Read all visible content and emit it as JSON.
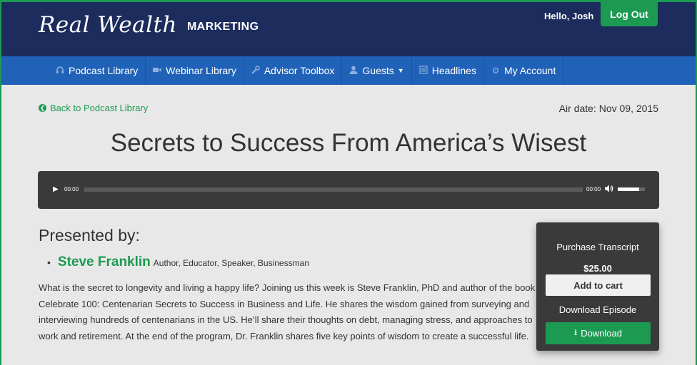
{
  "header": {
    "logo_script": "Real Wealth",
    "logo_word": "MARKETING",
    "greeting": "Hello, Josh",
    "logout_label": "Log Out"
  },
  "nav": {
    "items": [
      {
        "label": "Podcast Library",
        "icon": "headphones-icon"
      },
      {
        "label": "Webinar Library",
        "icon": "video-camera-icon"
      },
      {
        "label": "Advisor Toolbox",
        "icon": "wrench-icon"
      },
      {
        "label": "Guests",
        "icon": "user-icon"
      },
      {
        "label": "Headlines",
        "icon": "newspaper-icon"
      },
      {
        "label": "My Account",
        "icon": "gear-icon"
      }
    ]
  },
  "page": {
    "back_label": "Back to Podcast Library",
    "air_date": "Air date: Nov 09, 2015",
    "title": "Secrets to Success From America’s Wisest"
  },
  "player": {
    "current_time": "00:00",
    "duration": "00:00",
    "progress": 0,
    "volume": 0.8
  },
  "presented": {
    "heading": "Presented by:",
    "name": "Steve Franklin",
    "roles": "Author, Educator, Speaker, Businessman"
  },
  "description": "What is the secret to longevity and living a happy life? Joining us this week is Steve Franklin, PhD and author of the book Celebrate 100: Centenarian Secrets to Success in Business and Life. He shares the wisdom gained from surveying and interviewing hundreds of centenarians in the US. He’ll share their thoughts on debt, managing stress, and approaches to work and retirement. At the end of the program, Dr. Franklin shares five key points of wisdom to create a successful life.",
  "purchase": {
    "transcript_title": "Purchase Transcript",
    "price": "$25.00",
    "add_to_cart": "Add to cart",
    "download_title": "Download Episode",
    "download_label": "Download"
  },
  "colors": {
    "header_bg": "#1c2c5c",
    "nav_bg": "#2062b8",
    "accent_green": "#1c9a52",
    "player_bg": "#3a3a3a"
  }
}
